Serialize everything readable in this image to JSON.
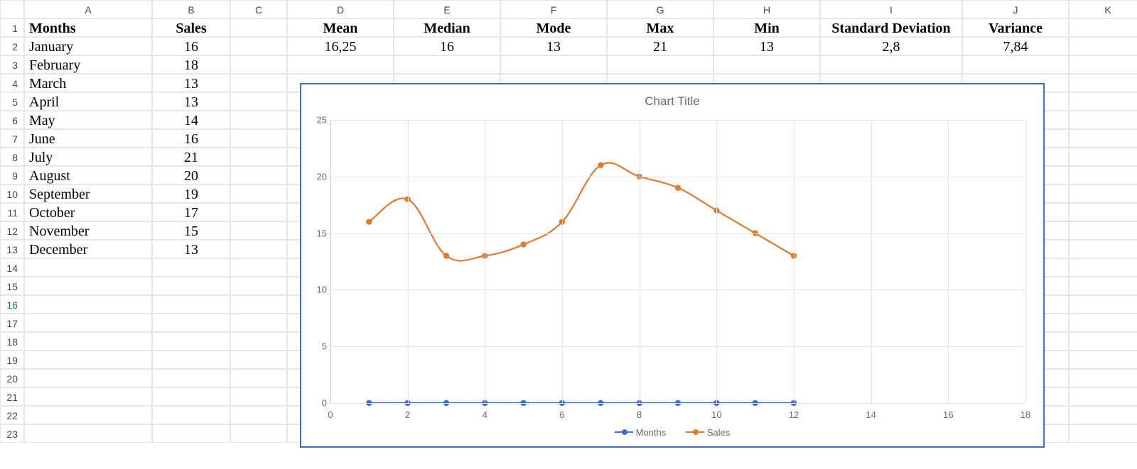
{
  "columns": [
    "A",
    "B",
    "C",
    "D",
    "E",
    "F",
    "G",
    "H",
    "I",
    "J",
    "K"
  ],
  "row_count": 23,
  "selected_row": 16,
  "table": {
    "months_header": "Months",
    "sales_header": "Sales",
    "rows": [
      {
        "month": "January",
        "sales": "16"
      },
      {
        "month": "February",
        "sales": "18"
      },
      {
        "month": "March",
        "sales": "13"
      },
      {
        "month": "April",
        "sales": "13"
      },
      {
        "month": "May",
        "sales": "14"
      },
      {
        "month": "June",
        "sales": "16"
      },
      {
        "month": "July",
        "sales": "21"
      },
      {
        "month": "August",
        "sales": "20"
      },
      {
        "month": "September",
        "sales": "19"
      },
      {
        "month": "October",
        "sales": "17"
      },
      {
        "month": "November",
        "sales": "15"
      },
      {
        "month": "December",
        "sales": "13"
      }
    ]
  },
  "stats": {
    "headers": [
      "Mean",
      "Median",
      "Mode",
      "Max",
      "Min",
      "Standard Deviation",
      "Variance"
    ],
    "values": [
      "16,25",
      "16",
      "13",
      "21",
      "13",
      "2,8",
      "7,84"
    ]
  },
  "chart_data": {
    "type": "line",
    "title": "Chart Title",
    "xlim": [
      0,
      18
    ],
    "ylim": [
      0,
      25
    ],
    "xticks": [
      0,
      2,
      4,
      6,
      8,
      10,
      12,
      14,
      16,
      18
    ],
    "yticks": [
      0,
      5,
      10,
      15,
      20,
      25
    ],
    "x": [
      1,
      2,
      3,
      4,
      5,
      6,
      7,
      8,
      9,
      10,
      11,
      12
    ],
    "series": [
      {
        "name": "Months",
        "color": "#3b6fd6",
        "values": [
          0,
          0,
          0,
          0,
          0,
          0,
          0,
          0,
          0,
          0,
          0,
          0
        ]
      },
      {
        "name": "Sales",
        "color": "#e07a2d",
        "values": [
          16,
          18,
          13,
          13,
          14,
          16,
          21,
          20,
          19,
          17,
          15,
          13
        ]
      }
    ]
  }
}
